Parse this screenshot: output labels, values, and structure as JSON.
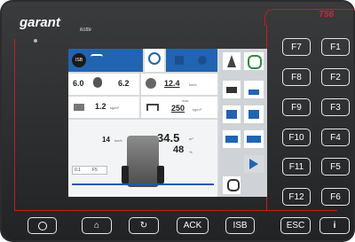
{
  "device": {
    "brand": "garant",
    "brand_sub": "kotte",
    "model": "T56"
  },
  "function_keys": [
    {
      "left": "F7",
      "right": "F1"
    },
    {
      "left": "F8",
      "right": "F2"
    },
    {
      "left": "F9",
      "right": "F3"
    },
    {
      "left": "F10",
      "right": "F4"
    },
    {
      "left": "F11",
      "right": "F5"
    },
    {
      "left": "F12",
      "right": "F6"
    }
  ],
  "bottom_keys": {
    "power": "power-icon",
    "home": "home-icon",
    "refresh": "refresh-icon",
    "ack": "ACK",
    "isb": "ISB",
    "esc": "ESC",
    "info": "i"
  },
  "screen": {
    "top_badge": "ISB",
    "row1": {
      "left_value": "6.0",
      "left_unit": "l/min",
      "mid_value": "6.2",
      "mid_unit": "l/min",
      "right_value": "12.4",
      "right_unit": "km/h"
    },
    "row2": {
      "left_value": "1.2",
      "left_unit": "kg/m³",
      "right_small": "max",
      "right_value": "250",
      "right_unit": "kg/m³"
    },
    "row3": {
      "left_value": "14",
      "left_unit": "km/h",
      "big_value": "34.5",
      "big_unit": "m³",
      "sub_value": "48",
      "sub_unit": "%"
    },
    "corner_label": "0.1",
    "corner_value": "F5"
  },
  "colors": {
    "bezel": "#2b2c2e",
    "accent": "#c41e23",
    "screen_blue": "#2164b2"
  }
}
